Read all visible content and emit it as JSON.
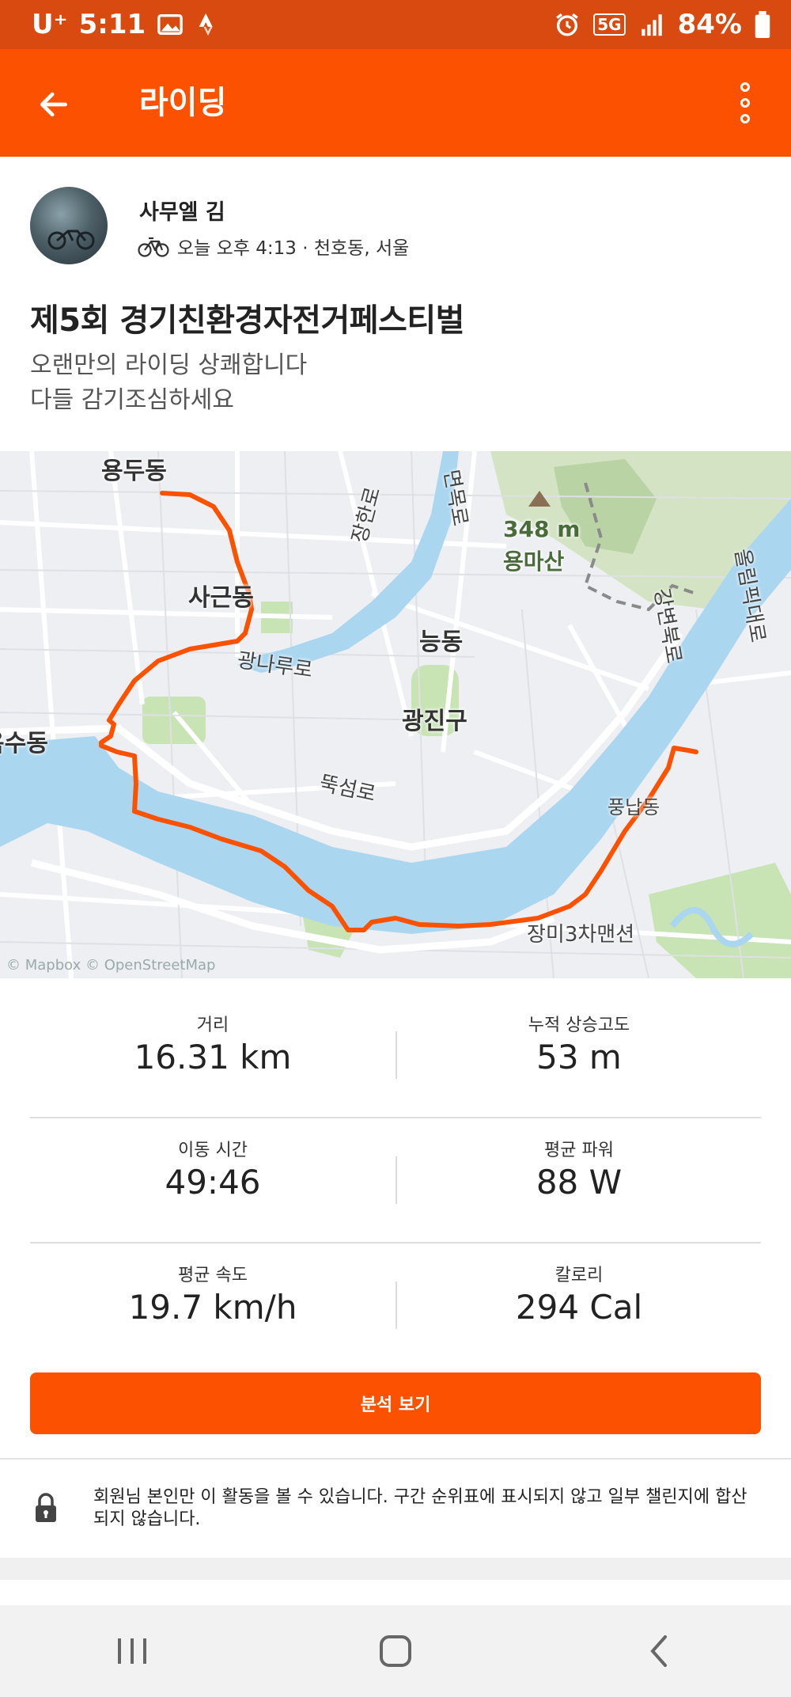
{
  "status_bar": {
    "carrier": "U⁺",
    "time": "5:11",
    "network": "5G",
    "battery": "84%"
  },
  "app_bar": {
    "title": "라이딩"
  },
  "athlete": {
    "name": "사무엘 김",
    "meta": "오늘 오후 4:13 · 천호동, 서울"
  },
  "activity": {
    "title": "제5회 경기친환경자전거페스티벌",
    "description_line1": "오랜만의 라이딩 상쾌합니다",
    "description_line2": "다들 감기조심하세요"
  },
  "map": {
    "labels": {
      "neighborhood_top": "용두동",
      "sageun": "사근동",
      "jangpyeong": "장한로",
      "myeonmok": "면목로",
      "mountain_height": "348 m",
      "mountain_name": "용마산",
      "neungdong": "능동",
      "gwangnaru": "광나루로",
      "gwangjin": "광진구",
      "oksu": "옥수동",
      "ttukseom": "뚝섬로",
      "gangbyeon": "강변북로",
      "olympic": "올림픽대로",
      "pungnap": "풍납동",
      "jangmi": "장미3차맨션"
    },
    "attribution": "© Mapbox © OpenStreetMap",
    "route_color": "#fc5200",
    "water_color": "#aad6f0"
  },
  "stats": [
    {
      "label": "거리",
      "value": "16.31 km"
    },
    {
      "label": "누적 상승고도",
      "value": "53 m"
    },
    {
      "label": "이동 시간",
      "value": "49:46"
    },
    {
      "label": "평균 파워",
      "value": "88 W"
    },
    {
      "label": "평균 속도",
      "value": "19.7 km/h"
    },
    {
      "label": "칼로리",
      "value": "294 Cal"
    }
  ],
  "analysis_button": {
    "label": "분석 보기"
  },
  "privacy": {
    "text": "회원님 본인만 이 활동을 볼 수 있습니다. 구간 순위표에 표시되지 않고 일부 챌린지에 합산되지 않습니다."
  },
  "colors": {
    "accent": "#fc5200",
    "status_bar": "#d84a0f"
  }
}
